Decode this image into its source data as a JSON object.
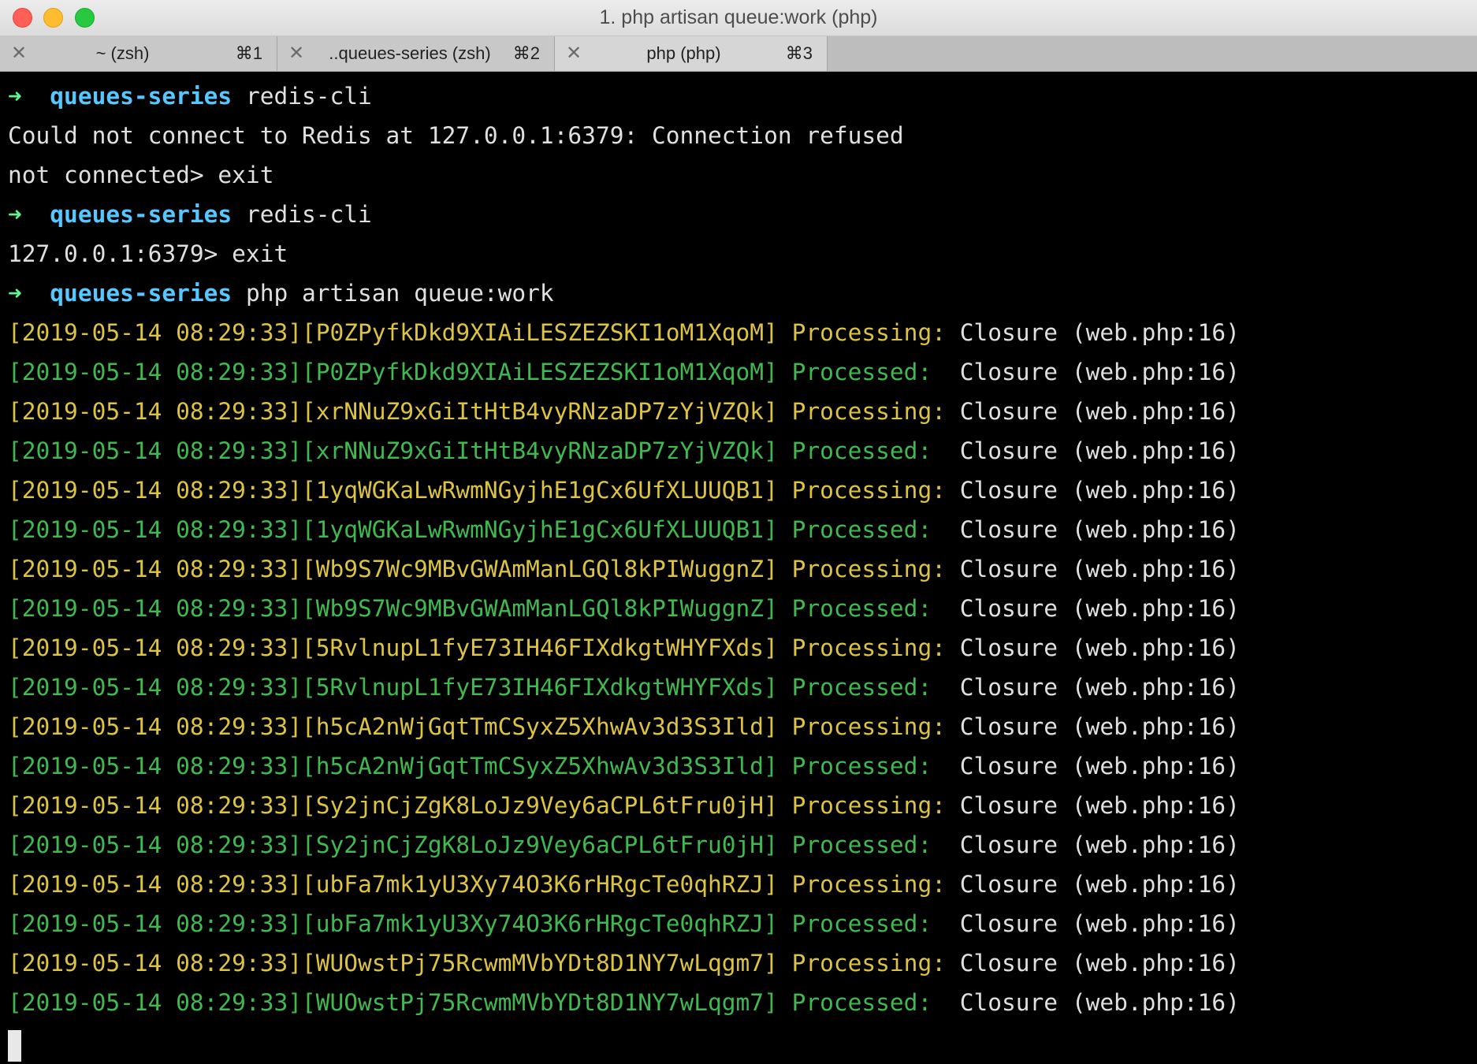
{
  "window": {
    "title": "1. php artisan queue:work (php)"
  },
  "tabs": [
    {
      "label": "~ (zsh)",
      "shortcut": "⌘1"
    },
    {
      "label": "..queues-series (zsh)",
      "shortcut": "⌘2"
    },
    {
      "label": "php (php)",
      "shortcut": "⌘3"
    }
  ],
  "icons": {
    "prompt_arrow": "➜",
    "tab_close": "✕"
  },
  "colors": {
    "prompt_arrow": "#5af78e",
    "prompt_dir": "#57c7ff",
    "processing": "#dcc341",
    "processed": "#3fb950"
  },
  "session": {
    "cmd1": {
      "dir": "queues-series",
      "command": "redis-cli"
    },
    "out1": "Could not connect to Redis at 127.0.0.1:6379: Connection refused",
    "out2": "not connected> exit",
    "cmd2": {
      "dir": "queues-series",
      "command": "redis-cli"
    },
    "out3": "127.0.0.1:6379> exit",
    "cmd3": {
      "dir": "queues-series",
      "command": "php artisan queue:work"
    }
  },
  "log": [
    {
      "prefix": "[2019-05-14 08:29:33][P0ZPyfkDkd9XIAiLESZEZSKI1oM1XqoM]",
      "status": "Processing:",
      "job": "Closure (web.php:16)"
    },
    {
      "prefix": "[2019-05-14 08:29:33][P0ZPyfkDkd9XIAiLESZEZSKI1oM1XqoM]",
      "status": "Processed: ",
      "job": "Closure (web.php:16)"
    },
    {
      "prefix": "[2019-05-14 08:29:33][xrNNuZ9xGiItHtB4vyRNzaDP7zYjVZQk]",
      "status": "Processing:",
      "job": "Closure (web.php:16)"
    },
    {
      "prefix": "[2019-05-14 08:29:33][xrNNuZ9xGiItHtB4vyRNzaDP7zYjVZQk]",
      "status": "Processed: ",
      "job": "Closure (web.php:16)"
    },
    {
      "prefix": "[2019-05-14 08:29:33][1yqWGKaLwRwmNGyjhE1gCx6UfXLUUQB1]",
      "status": "Processing:",
      "job": "Closure (web.php:16)"
    },
    {
      "prefix": "[2019-05-14 08:29:33][1yqWGKaLwRwmNGyjhE1gCx6UfXLUUQB1]",
      "status": "Processed: ",
      "job": "Closure (web.php:16)"
    },
    {
      "prefix": "[2019-05-14 08:29:33][Wb9S7Wc9MBvGWAmManLGQl8kPIWuggnZ]",
      "status": "Processing:",
      "job": "Closure (web.php:16)"
    },
    {
      "prefix": "[2019-05-14 08:29:33][Wb9S7Wc9MBvGWAmManLGQl8kPIWuggnZ]",
      "status": "Processed: ",
      "job": "Closure (web.php:16)"
    },
    {
      "prefix": "[2019-05-14 08:29:33][5RvlnupL1fyE73IH46FIXdkgtWHYFXds]",
      "status": "Processing:",
      "job": "Closure (web.php:16)"
    },
    {
      "prefix": "[2019-05-14 08:29:33][5RvlnupL1fyE73IH46FIXdkgtWHYFXds]",
      "status": "Processed: ",
      "job": "Closure (web.php:16)"
    },
    {
      "prefix": "[2019-05-14 08:29:33][h5cA2nWjGqtTmCSyxZ5XhwAv3d3S3Ild]",
      "status": "Processing:",
      "job": "Closure (web.php:16)"
    },
    {
      "prefix": "[2019-05-14 08:29:33][h5cA2nWjGqtTmCSyxZ5XhwAv3d3S3Ild]",
      "status": "Processed: ",
      "job": "Closure (web.php:16)"
    },
    {
      "prefix": "[2019-05-14 08:29:33][Sy2jnCjZgK8LoJz9Vey6aCPL6tFru0jH]",
      "status": "Processing:",
      "job": "Closure (web.php:16)"
    },
    {
      "prefix": "[2019-05-14 08:29:33][Sy2jnCjZgK8LoJz9Vey6aCPL6tFru0jH]",
      "status": "Processed: ",
      "job": "Closure (web.php:16)"
    },
    {
      "prefix": "[2019-05-14 08:29:33][ubFa7mk1yU3Xy74O3K6rHRgcTe0qhRZJ]",
      "status": "Processing:",
      "job": "Closure (web.php:16)"
    },
    {
      "prefix": "[2019-05-14 08:29:33][ubFa7mk1yU3Xy74O3K6rHRgcTe0qhRZJ]",
      "status": "Processed: ",
      "job": "Closure (web.php:16)"
    },
    {
      "prefix": "[2019-05-14 08:29:33][WUOwstPj75RcwmMVbYDt8D1NY7wLqgm7]",
      "status": "Processing:",
      "job": "Closure (web.php:16)"
    },
    {
      "prefix": "[2019-05-14 08:29:33][WUOwstPj75RcwmMVbYDt8D1NY7wLqgm7]",
      "status": "Processed: ",
      "job": "Closure (web.php:16)"
    }
  ]
}
